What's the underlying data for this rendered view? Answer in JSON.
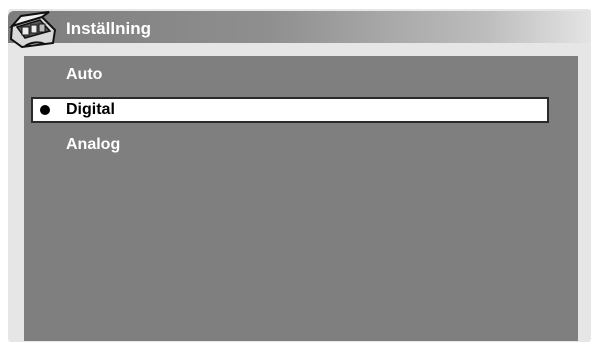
{
  "title": {
    "text": "Inställning",
    "icon": "tool-case-icon"
  },
  "menu": {
    "items": [
      {
        "label": "Auto",
        "selected": false
      },
      {
        "label": "Digital",
        "selected": true
      },
      {
        "label": "Analog",
        "selected": false
      }
    ]
  },
  "colors": {
    "panel_background": "#7f7f7f",
    "selected_background": "#ffffff",
    "text_light": "#ffffff",
    "text_dark": "#000000"
  }
}
